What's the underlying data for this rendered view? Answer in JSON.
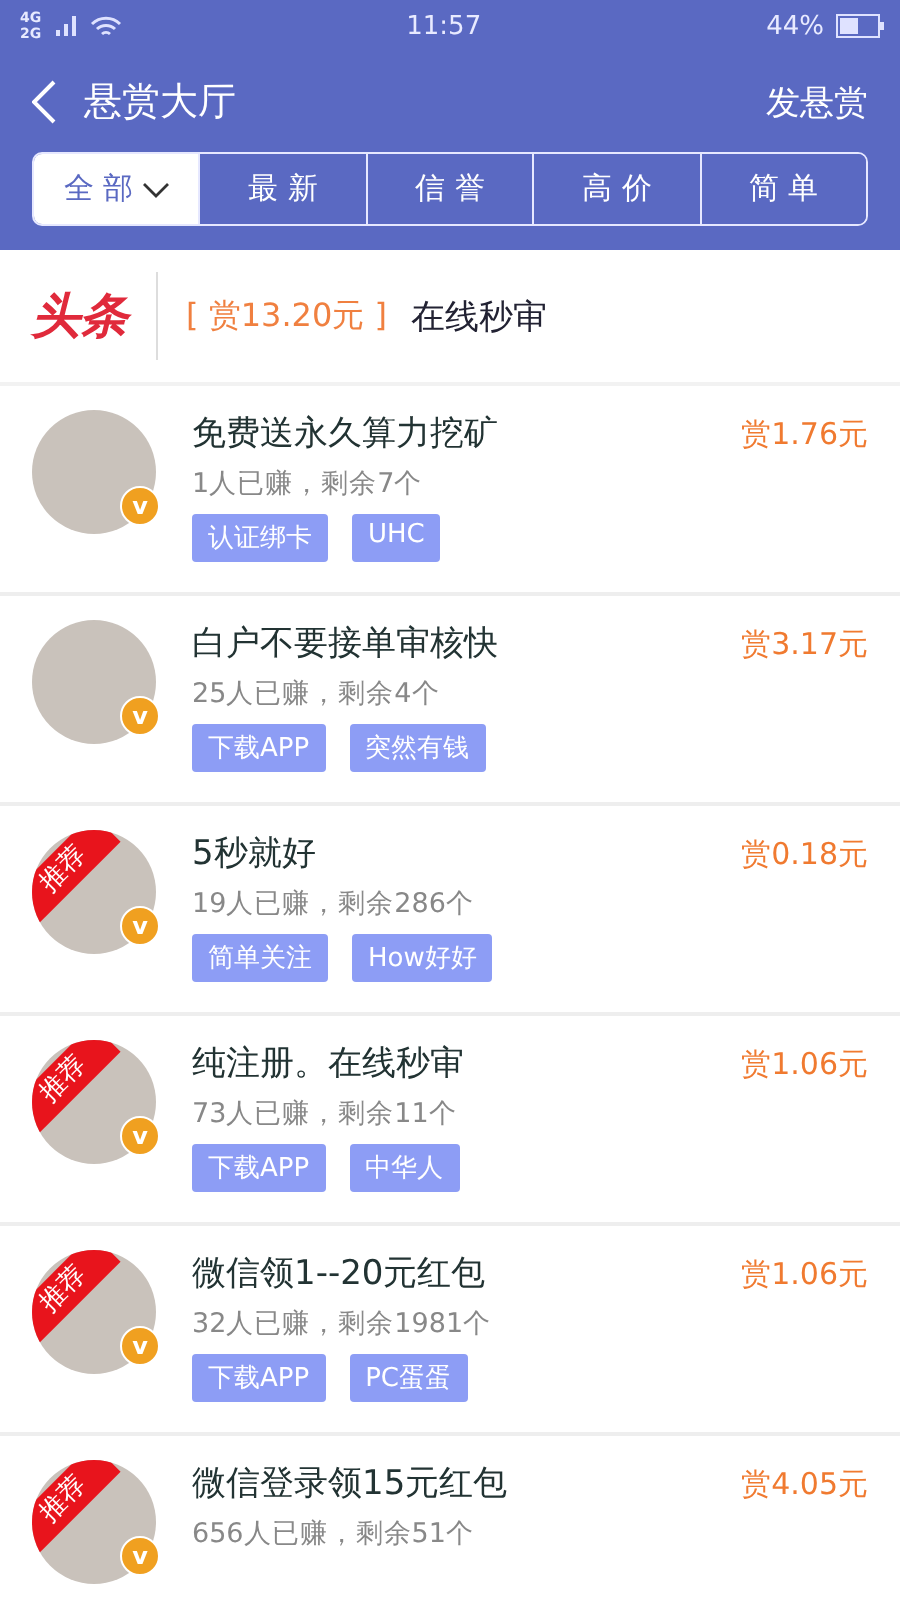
{
  "status_bar": {
    "network": [
      "4G",
      "2G"
    ],
    "time": "11:57",
    "battery": "44%"
  },
  "nav": {
    "title": "悬赏大厅",
    "action": "发悬赏"
  },
  "filters": [
    {
      "label": "全 部",
      "selected": true,
      "dropdown": true
    },
    {
      "label": "最 新",
      "selected": false
    },
    {
      "label": "信 誉",
      "selected": false
    },
    {
      "label": "高 价",
      "selected": false
    },
    {
      "label": "简 单",
      "selected": false
    }
  ],
  "headline": {
    "logo": "头条",
    "reward": "[ 赏13.20元 ]",
    "text": "在线秒审"
  },
  "tasks": [
    {
      "title": "免费送永久算力挖矿",
      "stats": "1人已赚，剩余7个",
      "reward": "赏1.76元",
      "tags": [
        "认证绑卡",
        "UHC"
      ],
      "verified": "v"
    },
    {
      "title": "白户不要接单审核快",
      "stats": "25人已赚，剩余4个",
      "reward": "赏3.17元",
      "tags": [
        "下载APP",
        "突然有钱"
      ],
      "verified": "v"
    },
    {
      "title": "5秒就好",
      "stats": "19人已赚，剩余286个",
      "reward": "赏0.18元",
      "tags": [
        "简单关注",
        "How好好"
      ],
      "recommended": "推荐",
      "verified": "v"
    },
    {
      "title": "纯注册。在线秒审",
      "stats": "73人已赚，剩余11个",
      "reward": "赏1.06元",
      "tags": [
        "下载APP",
        "中华人"
      ],
      "recommended": "推荐",
      "verified": "v"
    },
    {
      "title": "微信领1--20元红包",
      "stats": "32人已赚，剩余1981个",
      "reward": "赏1.06元",
      "tags": [
        "下载APP",
        "PC蛋蛋"
      ],
      "recommended": "推荐",
      "verified": "v"
    },
    {
      "title": "微信登录领15元红包",
      "stats": "656人已赚，剩余51个",
      "reward": "赏4.05元",
      "recommended": "推荐",
      "verified": "v"
    }
  ]
}
